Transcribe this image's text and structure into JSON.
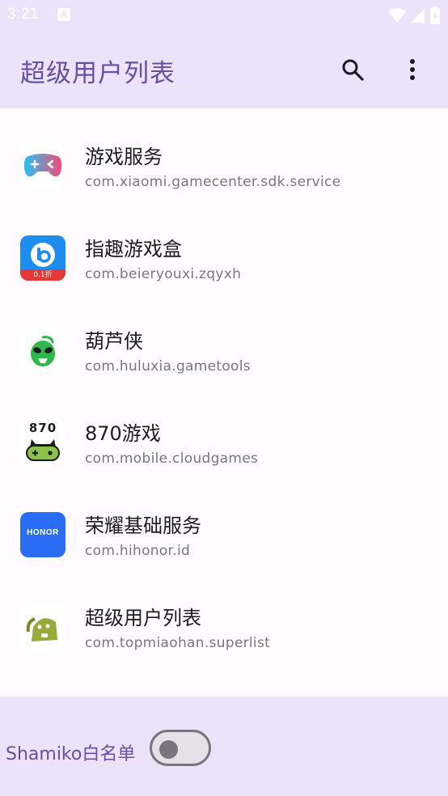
{
  "status_bar": {
    "time": "3:21",
    "notification_icon": "a-badge-icon",
    "icons": [
      "wifi-icon",
      "signal-icon",
      "battery-icon"
    ]
  },
  "app_bar": {
    "title": "超级用户列表",
    "actions": [
      "search-icon",
      "more-vert-icon"
    ]
  },
  "apps": [
    {
      "name": "游戏服务",
      "package": "com.xiaomi.gamecenter.sdk.service",
      "icon": "gamepad-icon"
    },
    {
      "name": "指趣游戏盒",
      "package": "com.beieryouxi.zqyxh",
      "icon": "zhiqu-icon",
      "icon_badge": "0.1折"
    },
    {
      "name": "葫芦侠",
      "package": "com.huluxia.gametools",
      "icon": "huluxia-icon"
    },
    {
      "name": "870游戏",
      "package": "com.mobile.cloudgames",
      "icon": "870-icon",
      "icon_text": "870"
    },
    {
      "name": "荣耀基础服务",
      "package": "com.hihonor.id",
      "icon": "honor-icon",
      "icon_text": "HONOR"
    },
    {
      "name": "超级用户列表",
      "package": "com.topmiaohan.superlist",
      "icon": "android-robot-icon"
    }
  ],
  "bottom_bar": {
    "switch_label": "Shamiko白名单",
    "switch_on": false
  },
  "colors": {
    "surface_tint": "#ece3fb",
    "primary": "#6750a4",
    "background": "#fffbfe",
    "honor_blue": "#2a6df4",
    "zhiqu_blue": "#1e8df0",
    "huluxia_green": "#2db84a"
  }
}
